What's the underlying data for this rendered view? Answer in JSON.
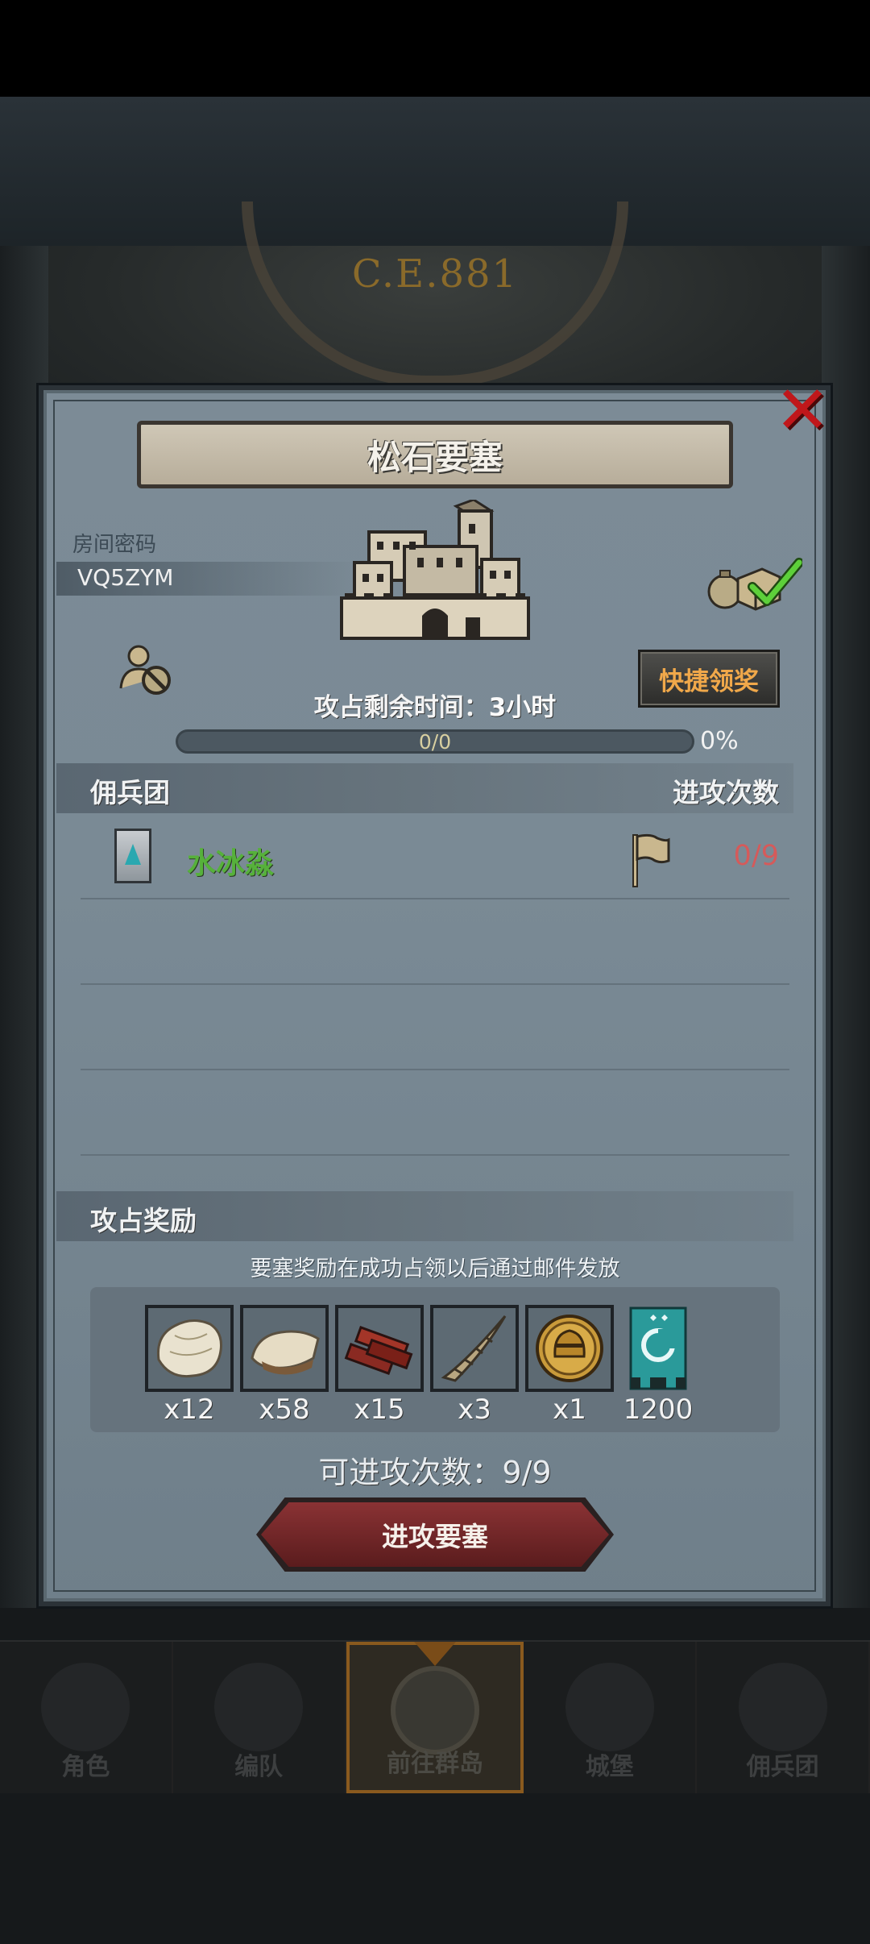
{
  "background": {
    "era_text": "C.E.881"
  },
  "modal": {
    "title": "松石要塞",
    "room": {
      "label": "房间密码",
      "code": "VQ5ZYM"
    },
    "quick_claim_label": "快捷领奖",
    "occupy_time": {
      "label": "攻占剩余时间：",
      "value": "3小时"
    },
    "progress": {
      "text": "0/0",
      "percent_label": "0%",
      "fraction": 0
    },
    "mercenary_section": {
      "left": "佣兵团",
      "right": "进攻次数"
    },
    "mercenaries": [
      {
        "name": "水冰淼",
        "attacks": "0/9"
      }
    ],
    "reward_section": {
      "title": "攻占奖励",
      "note": "要塞奖励在成功占领以后通过邮件发放"
    },
    "rewards": [
      {
        "icon": "hide-icon",
        "qty": "x12"
      },
      {
        "icon": "fur-icon",
        "qty": "x58"
      },
      {
        "icon": "wood-planks-icon",
        "qty": "x15"
      },
      {
        "icon": "horn-icon",
        "qty": "x3"
      },
      {
        "icon": "knight-helmet-coin-icon",
        "qty": "x1"
      },
      {
        "icon": "guild-banner-icon",
        "qty": "1200"
      }
    ],
    "attempts": "可进攻次数：9/9",
    "attack_button": "进攻要塞"
  },
  "bottom_nav": {
    "items": [
      {
        "label": "角色",
        "icon": "character-icon"
      },
      {
        "label": "编队",
        "icon": "formation-icon"
      },
      {
        "label": "前往群岛",
        "icon": "islands-globe-icon"
      },
      {
        "label": "城堡",
        "icon": "castle-icon"
      },
      {
        "label": "佣兵团",
        "icon": "mercenary-icon"
      }
    ],
    "active_index": 2
  },
  "colors": {
    "close": "#c0171b",
    "merc_name": "#56b13b",
    "attack_count": "#d55a5a",
    "quick_claim_text": "#f0a84a",
    "nav_active_border": "#8a5a1e"
  }
}
